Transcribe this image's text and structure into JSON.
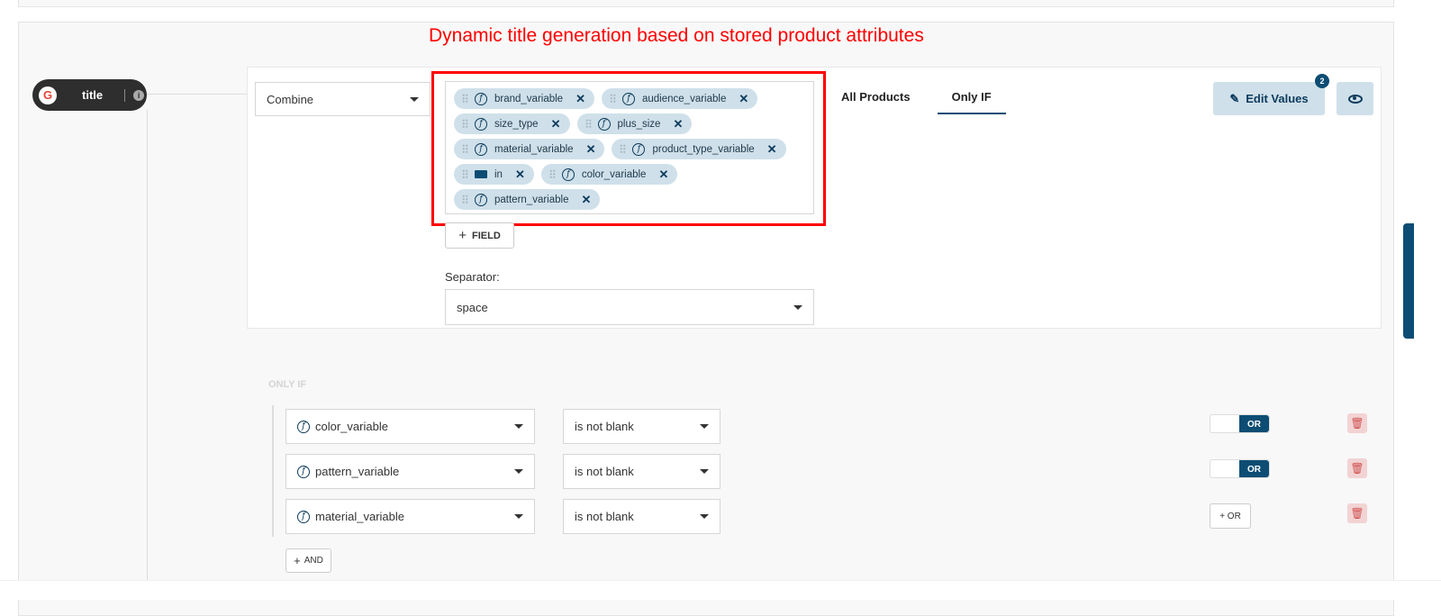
{
  "annotation": "Dynamic title generation based on stored product attributes",
  "node": {
    "label": "title",
    "icon": "google-icon",
    "info_icon": "info-icon"
  },
  "rule": {
    "mode": "Combine",
    "fields": [
      [
        {
          "label": "brand_variable",
          "type": "function"
        },
        {
          "label": "audience_variable",
          "type": "function"
        }
      ],
      [
        {
          "label": "size_type",
          "type": "function"
        },
        {
          "label": "plus_size",
          "type": "function"
        }
      ],
      [
        {
          "label": "material_variable",
          "type": "function"
        },
        {
          "label": "product_type_variable",
          "type": "function"
        }
      ],
      [
        {
          "label": "in",
          "type": "text"
        },
        {
          "label": "color_variable",
          "type": "function"
        }
      ],
      [
        {
          "label": "pattern_variable",
          "type": "function"
        }
      ]
    ],
    "add_field_label": "FIELD",
    "separator_label": "Separator:",
    "separator_value": "space"
  },
  "tabs": [
    {
      "label": "All Products"
    },
    {
      "label": "Only IF",
      "active": true
    }
  ],
  "edit_values": {
    "label": "Edit Values",
    "badge": "2"
  },
  "only_if": {
    "heading": "ONLY IF",
    "conditions": [
      {
        "field": "color_variable",
        "operator": "is not blank",
        "connector": "OR"
      },
      {
        "field": "pattern_variable",
        "operator": "is not blank",
        "connector": "OR"
      },
      {
        "field": "material_variable",
        "operator": "is not blank",
        "connector": "+ OR"
      }
    ],
    "and_label": "AND"
  },
  "colors": {
    "accent": "#0d4d73",
    "chip": "#cfe0ea",
    "annotation": "#ff0000"
  }
}
